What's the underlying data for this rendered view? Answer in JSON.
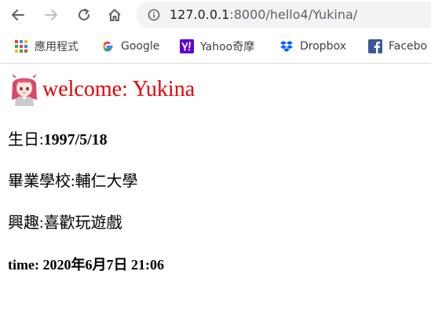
{
  "browser": {
    "url_host": "127.0.0.1",
    "url_rest": ":8000/hello4/Yukina/",
    "bookmarks": [
      {
        "label": "應用程式",
        "icon": "apps-grid-icon"
      },
      {
        "label": "Google",
        "icon": "google-icon"
      },
      {
        "label": "Yahoo奇摩",
        "icon": "yahoo-icon"
      },
      {
        "label": "Dropbox",
        "icon": "dropbox-icon"
      },
      {
        "label": "Facebo",
        "icon": "facebook-icon"
      }
    ]
  },
  "page": {
    "welcome": "welcome: Yukina",
    "birthday_label": "生日:",
    "birthday_value": "1997/5/18",
    "school_label": "畢業學校:",
    "school_value": "輔仁大學",
    "hobby_label": "興趣:",
    "hobby_value": "喜歡玩遊戲",
    "time_text": "time: 2020年6月7日 21:06"
  },
  "colors": {
    "welcome": "#e60000",
    "omnibox_bg": "#f1f3f4",
    "divider": "#dadce0"
  }
}
